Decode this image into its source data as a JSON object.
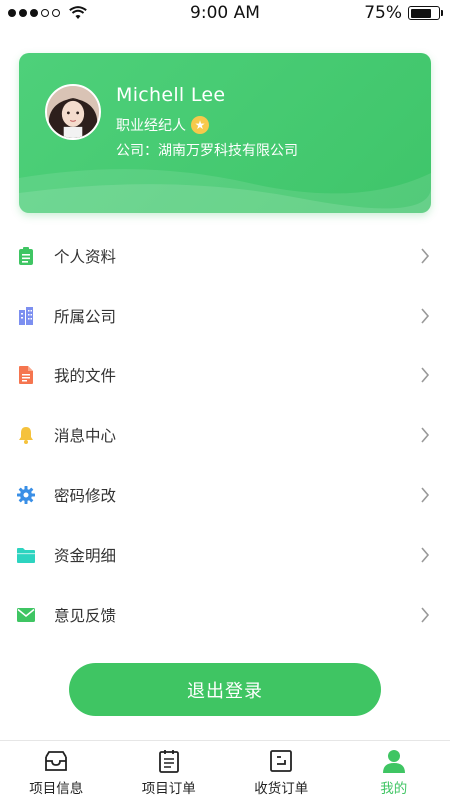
{
  "status_bar": {
    "time": "9:00 AM",
    "battery": "75%",
    "battery_level": 0.75
  },
  "profile": {
    "name": "Michell Lee",
    "title": "职业经纪人",
    "company": "公司：湖南万罗科技有限公司"
  },
  "menu": {
    "items": [
      {
        "label": "个人资料",
        "icon": "clipboard-icon",
        "color": "#3fc563"
      },
      {
        "label": "所属公司",
        "icon": "building-icon",
        "color": "#7c8ff0"
      },
      {
        "label": "我的文件",
        "icon": "document-icon",
        "color": "#f5754f"
      },
      {
        "label": "消息中心",
        "icon": "bell-icon",
        "color": "#f5c23c"
      },
      {
        "label": "密码修改",
        "icon": "gear-icon",
        "color": "#3a8fe6"
      },
      {
        "label": "资金明细",
        "icon": "folder-icon",
        "color": "#2dd4c0"
      },
      {
        "label": "意见反馈",
        "icon": "mail-icon",
        "color": "#3fc563"
      }
    ]
  },
  "logout_label": "退出登录",
  "tabs": [
    {
      "label": "项目信息",
      "icon": "inbox-icon",
      "active": false
    },
    {
      "label": "项目订单",
      "icon": "calendar-list-icon",
      "active": false
    },
    {
      "label": "收货订单",
      "icon": "order-box-icon",
      "active": false
    },
    {
      "label": "我的",
      "icon": "person-icon",
      "active": true
    }
  ],
  "colors": {
    "accent": "#3fc563",
    "card": "#4ed07a",
    "star": "#f7c94b"
  }
}
